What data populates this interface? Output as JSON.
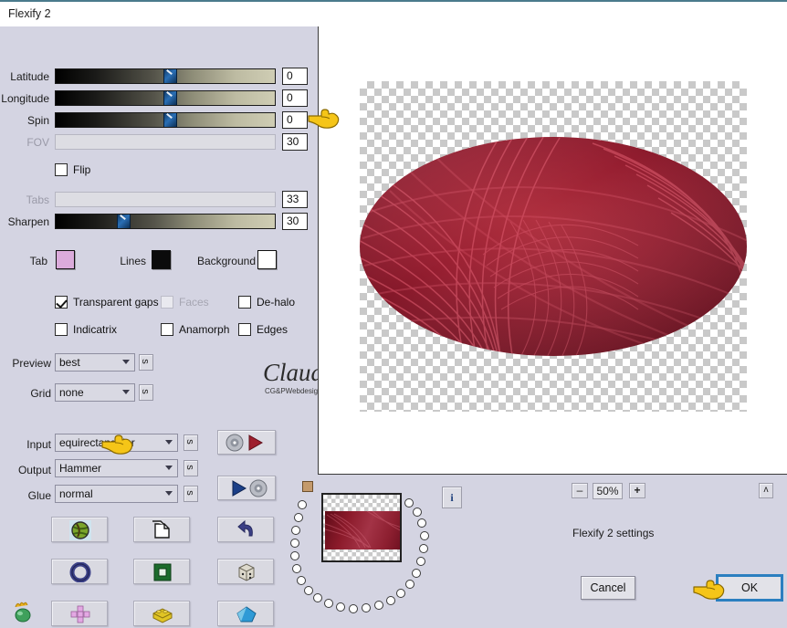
{
  "window": {
    "title": "Flexify 2"
  },
  "sliders": [
    {
      "label": "Latitude",
      "value": "0",
      "enabled": true,
      "pos": 0.53
    },
    {
      "label": "Longitude",
      "value": "0",
      "enabled": true,
      "pos": 0.53
    },
    {
      "label": "Spin",
      "value": "0",
      "enabled": true,
      "pos": 0.53
    },
    {
      "label": "FOV",
      "value": "30",
      "enabled": false,
      "pos": 0.0
    },
    {
      "label": "Tabs",
      "value": "33",
      "enabled": false,
      "pos": 0.0
    },
    {
      "label": "Sharpen",
      "value": "30",
      "enabled": true,
      "pos": 0.3
    }
  ],
  "flip": {
    "label": "Flip",
    "checked": false
  },
  "colors": {
    "tab": {
      "label": "Tab",
      "value": "#dbabdb"
    },
    "lines": {
      "label": "Lines",
      "value": "#0b0b0b"
    },
    "background": {
      "label": "Background",
      "value": "#ffffff"
    }
  },
  "checkboxes": [
    {
      "label": "Transparent gaps",
      "checked": true,
      "enabled": true
    },
    {
      "label": "Faces",
      "checked": false,
      "enabled": false
    },
    {
      "label": "De-halo",
      "checked": false,
      "enabled": true
    },
    {
      "label": "Indicatrix",
      "checked": false,
      "enabled": true
    },
    {
      "label": "Anamorph",
      "checked": false,
      "enabled": true
    },
    {
      "label": "Edges",
      "checked": false,
      "enabled": true
    }
  ],
  "selects": [
    {
      "label": "Preview",
      "value": "best",
      "side_button": "s"
    },
    {
      "label": "Grid",
      "value": "none",
      "side_button": "s"
    },
    {
      "label": "Input",
      "value": "equirectangular",
      "side_button": "s"
    },
    {
      "label": "Output",
      "value": "Hammer",
      "side_button": "s"
    },
    {
      "label": "Glue",
      "value": "normal",
      "side_button": "s"
    }
  ],
  "disk_buttons": [
    {
      "name": "load-settings-button"
    },
    {
      "name": "save-settings-button"
    }
  ],
  "icon_buttons": [
    {
      "name": "globe-preset-button",
      "icon": "globe-icon"
    },
    {
      "name": "page-preset-button",
      "icon": "pages-icon"
    },
    {
      "name": "undo-button",
      "icon": "undo-arrow-icon"
    },
    {
      "name": "torus-preset-button",
      "icon": "torus-icon"
    },
    {
      "name": "frame-preset-button",
      "icon": "square-frame-icon"
    },
    {
      "name": "dice-preset-button",
      "icon": "dice-icon"
    },
    {
      "name": "cross-preset-button",
      "icon": "cross-net-icon"
    },
    {
      "name": "brick-preset-button",
      "icon": "brick-icon"
    },
    {
      "name": "polygon-preset-button",
      "icon": "polyhedron-icon"
    }
  ],
  "flame_icon": {
    "name": "flame-gem-icon"
  },
  "watermark": {
    "name": "Claudia",
    "sub": "CG&PWebdesign"
  },
  "bottom": {
    "info_button": "i",
    "zoom_out": "–",
    "zoom_level": "50%",
    "zoom_in": "+",
    "collapse": "ʌ",
    "status": "Flexify 2 settings",
    "cancel": "Cancel",
    "ok": "OK"
  },
  "preview": {
    "projection": "Hammer",
    "description": "red interlaced-curve texture mapped to Hammer ellipse on transparent checkerboard"
  }
}
